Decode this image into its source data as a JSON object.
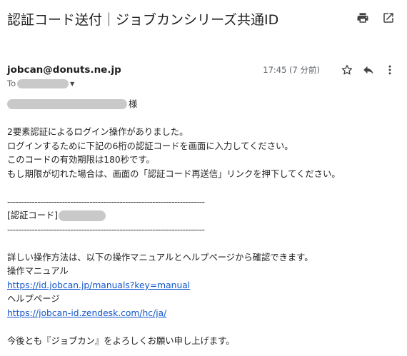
{
  "email": {
    "subject": "認証コード送付｜ジョブカンシリーズ共通ID",
    "sender": "jobcan@donuts.ne.jp",
    "to_label": "To",
    "time": "17:45 (7 分前)",
    "icons": {
      "print": "print-icon",
      "open_new": "open-in-new-window-icon",
      "star": "star-icon",
      "reply": "reply-icon",
      "more": "more-vert-icon",
      "caret": "caret-down-icon"
    }
  },
  "body": {
    "honorific": "様",
    "p1": "2要素認証によるログイン操作がありました。",
    "p2": "ログインするために下記の6桁の認証コードを画面に入力してください。",
    "p3": "このコードの有効期限は180秒です。",
    "p4": "もし期限が切れた場合は、画面の「認証コード再送信」リンクを押下してください。",
    "separator": "------------------------------------------------------------------------",
    "code_label": "[認証コード]",
    "p5": "詳しい操作方法は、以下の操作マニュアルとヘルプページから確認できます。",
    "manual_label": "操作マニュアル",
    "manual_url": "https://id.jobcan.jp/manuals?key=manual",
    "help_label": "ヘルプページ",
    "help_url": "https://jobcan-id.zendesk.com/hc/ja/",
    "closing": "今後とも『ジョブカン』をよろしくお願い申し上げます。"
  }
}
